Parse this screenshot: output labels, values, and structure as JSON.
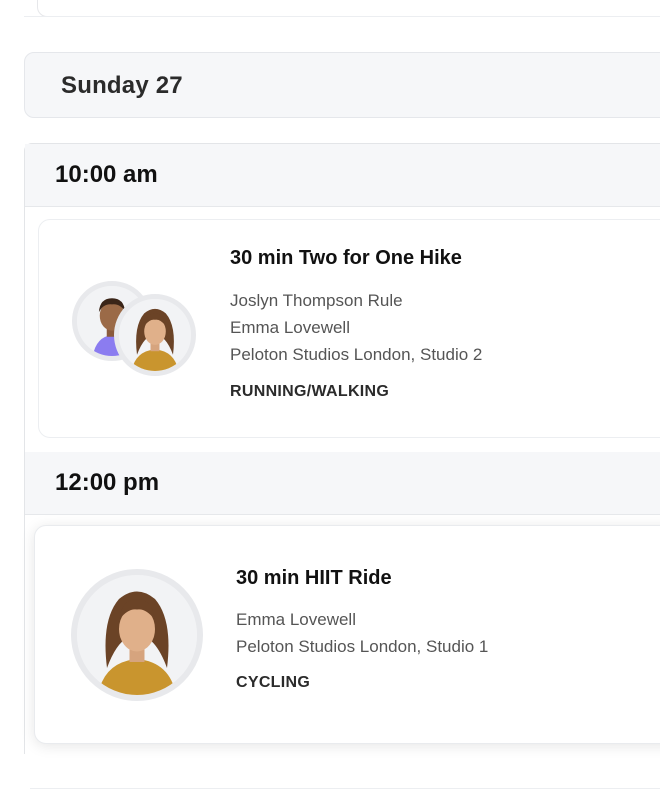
{
  "day": {
    "title": "Sunday 27"
  },
  "slots": [
    {
      "time": "10:00 am",
      "class": {
        "title": "30 min Two for One Hike",
        "instructors": [
          "Joslyn Thompson Rule",
          "Emma Lovewell"
        ],
        "location": "Peloton Studios London, Studio 2",
        "category": "RUNNING/WALKING"
      }
    },
    {
      "time": "12:00 pm",
      "class": {
        "title": "30 min HIIT Ride",
        "instructors": [
          "Emma Lovewell"
        ],
        "location": "Peloton Studios London, Studio 1",
        "category": "CYCLING"
      }
    }
  ],
  "colors": {
    "header_bg": "#f6f7f9",
    "card_border": "#eceef1",
    "avatar_ring": "#e8e9ec",
    "accent_top_purple": "#8b7cf0",
    "accent_top_mustard": "#c9952e"
  }
}
